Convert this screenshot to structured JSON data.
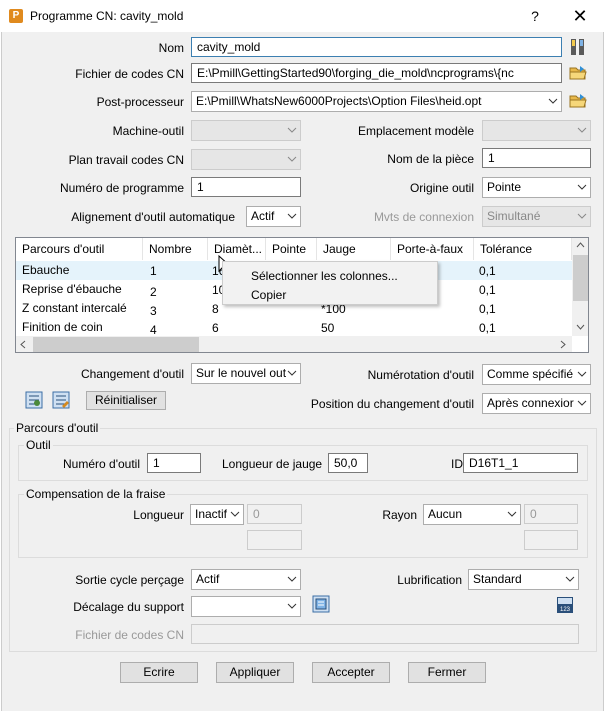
{
  "window": {
    "title": "Programme CN: cavity_mold",
    "help": "?",
    "close": "✕",
    "app_icon": "P"
  },
  "fields": {
    "nom_label": "Nom",
    "nom_value": "cavity_mold",
    "fichier_label": "Fichier de codes CN",
    "fichier_value": "E:\\Pmill\\GettingStarted90\\forging_die_mold\\ncprograms\\{nc",
    "post_label": "Post-processeur",
    "post_value": "E:\\Pmill\\WhatsNew6000Projects\\Option Files\\heid.opt",
    "machine_label": "Machine-outil",
    "machine_value": "",
    "emplacement_label": "Emplacement modèle",
    "emplacement_value": "",
    "plan_label": "Plan travail codes CN",
    "plan_value": "",
    "piece_label": "Nom de la pièce",
    "piece_value": "1",
    "numprog_label": "Numéro de programme",
    "numprog_value": "1",
    "origine_label": "Origine outil",
    "origine_value": "Pointe",
    "alignement_label": "Alignement d'outil automatique",
    "alignement_value": "Actif",
    "mvts_label": "Mvts de connexion",
    "mvts_value": "Simultané"
  },
  "grid": {
    "columns": [
      "Parcours d'outil",
      "Nombre",
      "Diamèt...",
      "Pointe",
      "Jauge",
      "Porte-à-faux",
      "Tolérance"
    ],
    "rows": [
      {
        "name": "Ebauche",
        "nombre": "1",
        "diam": "16",
        "jauge": "",
        "tol": "0,1"
      },
      {
        "name": "Reprise d'ébauche",
        "nombre": "2",
        "diam": "10",
        "jauge": "",
        "tol": "0,1"
      },
      {
        "name": "Z constant intercalé",
        "nombre": "3",
        "diam": "8",
        "jauge": "*100",
        "tol": "0,1"
      },
      {
        "name": "Finition de coin",
        "nombre": "4",
        "diam": "6",
        "jauge": "50",
        "tol": "0,1"
      }
    ]
  },
  "context_menu": {
    "item1": "Sélectionner les colonnes...",
    "item2": "Copier"
  },
  "changement": {
    "label": "Changement d'outil",
    "value": "Sur le nouvel out",
    "numerotation_label": "Numérotation d'outil",
    "numerotation_value": "Comme spécifié",
    "position_label": "Position du changement d'outil",
    "position_value": "Après connexior",
    "reset_label": "Réinitialiser"
  },
  "parcours": {
    "group_label": "Parcours d'outil",
    "outil_group": "Outil",
    "numero_label": "Numéro d'outil",
    "numero_value": "1",
    "longueur_jauge_label": "Longueur de jauge",
    "longueur_jauge_value": "50,0",
    "id_label": "ID",
    "id_value": "D16T1_1",
    "comp_group": "Compensation de la fraise",
    "longueur_label": "Longueur",
    "longueur_value": "Inactif",
    "longueur_num": "0",
    "rayon_label": "Rayon",
    "rayon_value": "Aucun",
    "rayon_num": "0"
  },
  "bottom": {
    "sortie_label": "Sortie cycle perçage",
    "sortie_value": "Actif",
    "lubrif_label": "Lubrification",
    "lubrif_value": "Standard",
    "decalage_label": "Décalage du support",
    "decalage_value": "",
    "fichier_label": "Fichier de codes CN",
    "fichier_value": ""
  },
  "buttons": {
    "ecrire": "Ecrire",
    "appliquer": "Appliquer",
    "accepter": "Accepter",
    "fermer": "Fermer"
  },
  "colors": {
    "accent": "#3c7fb1",
    "dialog_bg": "#f0f0f0",
    "row_highlight": "#e5f3fb"
  }
}
